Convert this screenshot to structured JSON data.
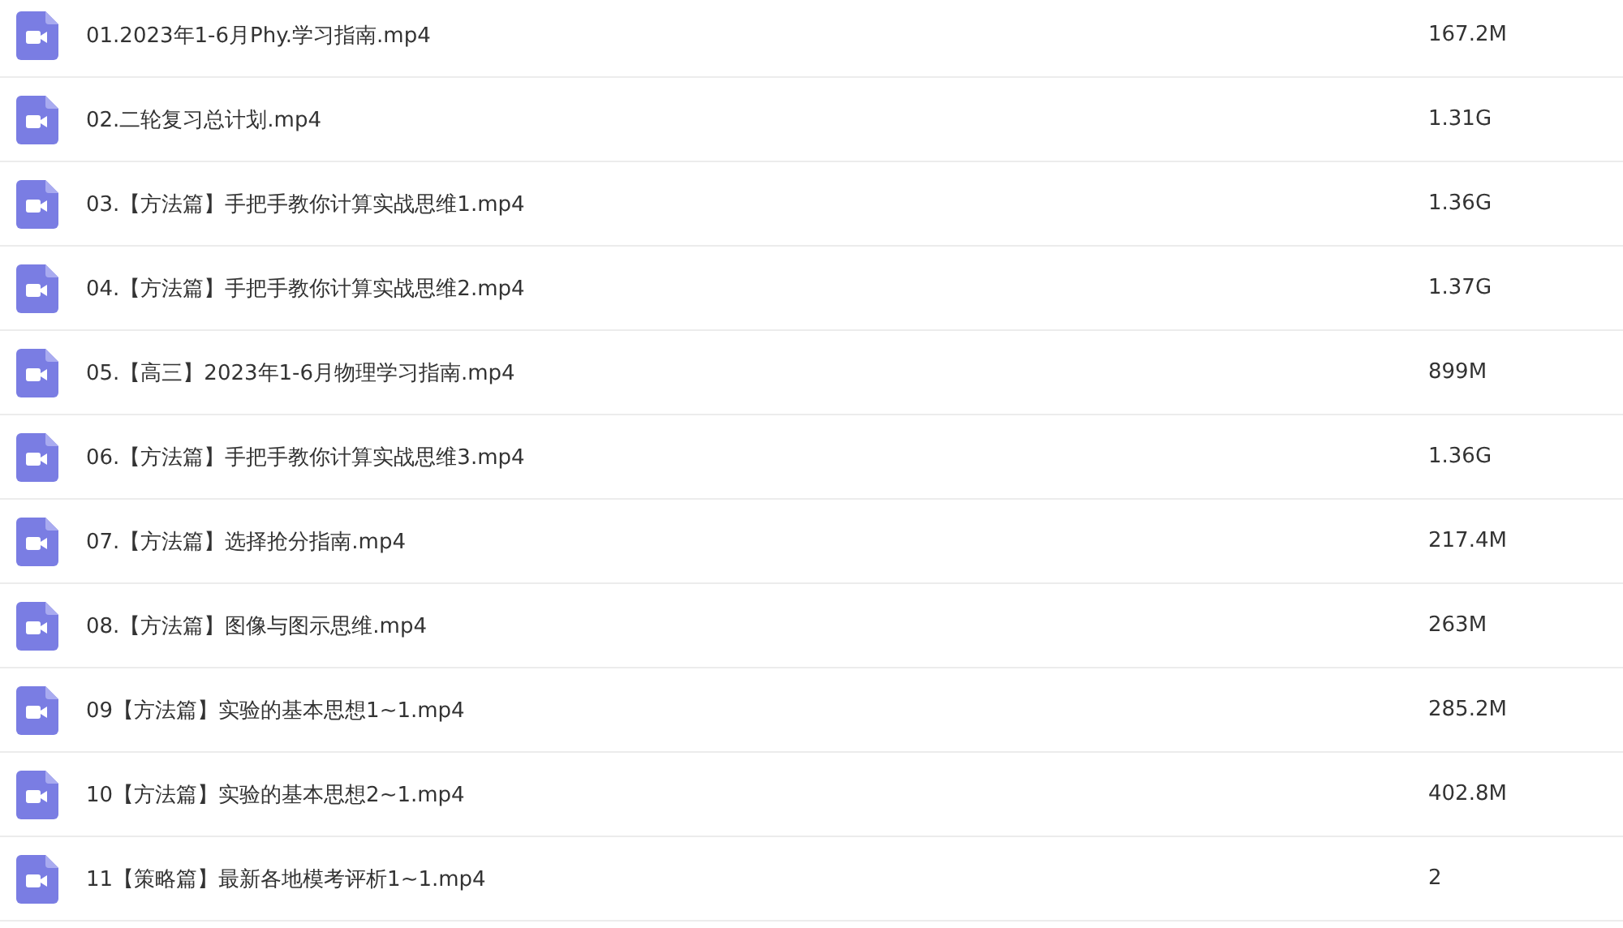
{
  "files": [
    {
      "name": "01.2023年1-6月Phy.学习指南.mp4",
      "size": "167.2M"
    },
    {
      "name": "02.二轮复习总计划.mp4",
      "size": "1.31G"
    },
    {
      "name": "03.【方法篇】手把手教你计算实战思维1.mp4",
      "size": "1.36G"
    },
    {
      "name": "04.【方法篇】手把手教你计算实战思维2.mp4",
      "size": "1.37G"
    },
    {
      "name": "05.【高三】2023年1-6月物理学习指南.mp4",
      "size": "899M"
    },
    {
      "name": "06.【方法篇】手把手教你计算实战思维3.mp4",
      "size": "1.36G"
    },
    {
      "name": "07.【方法篇】选择抢分指南.mp4",
      "size": "217.4M"
    },
    {
      "name": "08.【方法篇】图像与图示思维.mp4",
      "size": "263M"
    },
    {
      "name": "09【方法篇】实验的基本思想1~1.mp4",
      "size": "285.2M"
    },
    {
      "name": "10【方法篇】实验的基本思想2~1.mp4",
      "size": "402.8M"
    },
    {
      "name": "11【策略篇】最新各地模考评析1~1.mp4",
      "size": "2"
    }
  ]
}
